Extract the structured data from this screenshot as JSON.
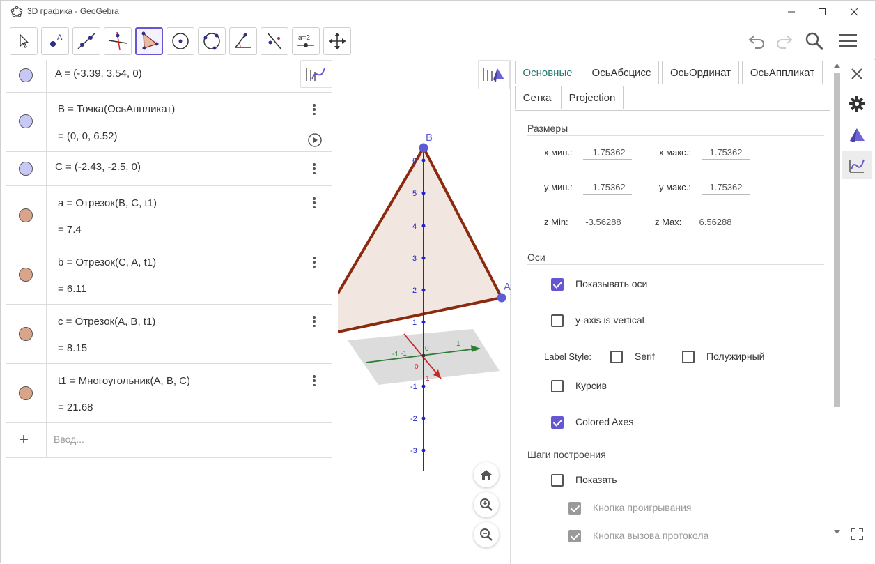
{
  "window": {
    "title": "3D графика - GeoGebra"
  },
  "algebra": {
    "items": [
      {
        "def": "A = (-3.39, 3.54, 0)",
        "value": "",
        "color": "#c8c8f6"
      },
      {
        "def": "B = Точка(ОсьАппликат)",
        "value": "= (0, 0, 6.52)",
        "color": "#c8c8f6"
      },
      {
        "def": "C = (-2.43, -2.5, 0)",
        "value": "",
        "color": "#c8c8f6"
      },
      {
        "def": "a = Отрезок(B, C, t1)",
        "value": "= 7.4",
        "color": "#d9a58a"
      },
      {
        "def": "b = Отрезок(C, A, t1)",
        "value": "= 6.11",
        "color": "#d9a58a"
      },
      {
        "def": "c = Отрезок(A, B, t1)",
        "value": "= 8.15",
        "color": "#d9a58a"
      },
      {
        "def": "t1 = Многоугольник(A, B, C)",
        "value": "= 21.68",
        "color": "#d9a58a"
      }
    ],
    "input_placeholder": "Ввод..."
  },
  "graphics": {
    "point_labels": [
      "B",
      "A"
    ],
    "z_ticks": [
      "6",
      "5",
      "4",
      "3",
      "2",
      "1",
      "-1",
      "-2",
      "-3"
    ],
    "floor_labels": [
      "-1",
      "-1",
      "0",
      "1",
      "0",
      "1"
    ]
  },
  "settings": {
    "tabs": [
      "Основные",
      "ОсьАбсцисс",
      "ОсьОрдинат",
      "ОсьАппликат",
      "Сетка",
      "Projection"
    ],
    "sections": {
      "dimensions": "Размеры",
      "axes": "Оси",
      "construction": "Шаги построения"
    },
    "dims": [
      {
        "label": "x мин.:",
        "value": "-1.75362"
      },
      {
        "label": "x макс.:",
        "value": "1.75362"
      },
      {
        "label": "y мин.:",
        "value": "-1.75362"
      },
      {
        "label": "y макс.:",
        "value": "1.75362"
      },
      {
        "label": "z Min:",
        "value": "-3.56288"
      },
      {
        "label": "z Max:",
        "value": "6.56288"
      }
    ],
    "axes_options": {
      "show_axes": "Показывать оси",
      "y_vertical": "y-axis is vertical",
      "label_style": "Label Style:",
      "serif": "Serif",
      "bold": "Полужирный",
      "italic": "Курсив",
      "colored": "Colored Axes"
    },
    "construction": {
      "show": "Показать",
      "play_button": "Кнопка проигрывания",
      "protocol_button": "Кнопка вызова протокола"
    }
  },
  "colors": {
    "accent": "#6557d2",
    "tab_active": "#1f7a6e",
    "point": "#5c5cd6",
    "segment": "#8b2a0e",
    "polygon_fill": "#f2e6e1"
  }
}
